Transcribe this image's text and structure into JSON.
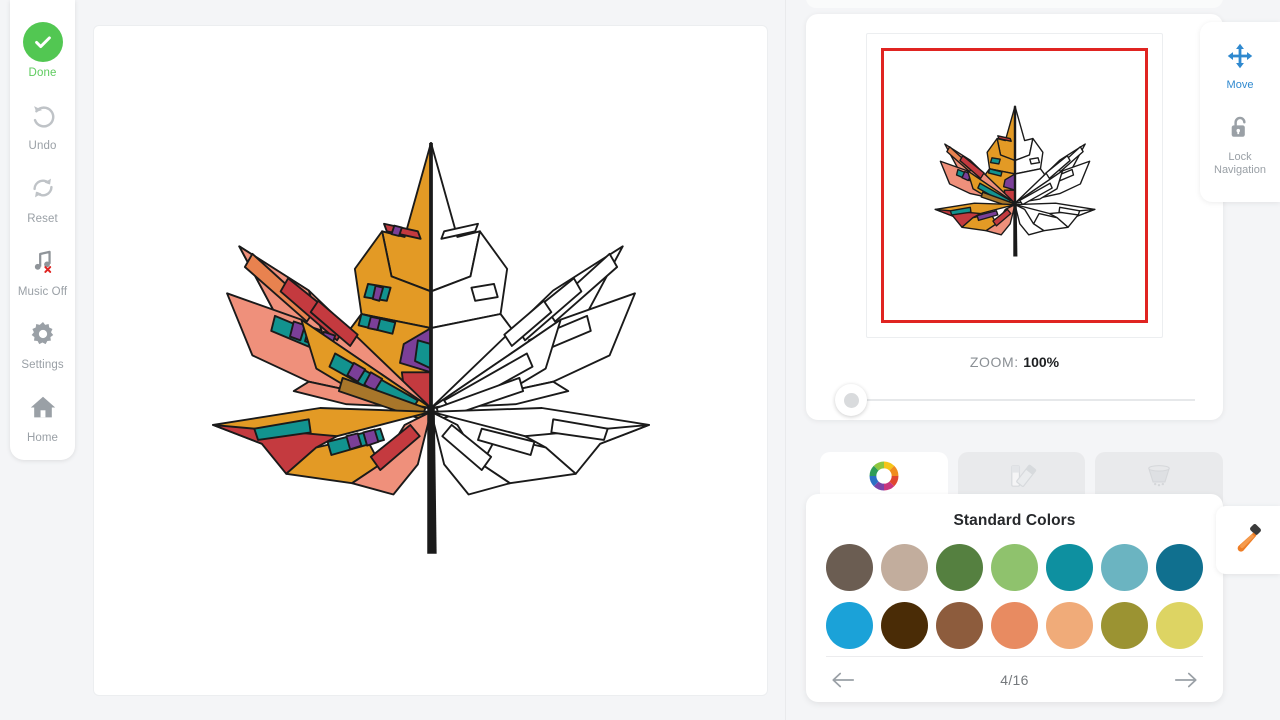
{
  "app": {
    "background": "#f4f5f7"
  },
  "toolbar": {
    "items": [
      {
        "label": "Done",
        "icon": "check-circle-icon",
        "state": "active",
        "color": "#52c752"
      },
      {
        "label": "Undo",
        "icon": "undo-arrow-icon",
        "state": "normal",
        "color": "#b9bdc1"
      },
      {
        "label": "Reset",
        "icon": "reset-refresh-icon",
        "state": "normal",
        "color": "#b9bdc1"
      },
      {
        "label": "Music Off",
        "icon": "music-note-off-icon",
        "state": "normal",
        "color": "#9aa0a6"
      },
      {
        "label": "Settings",
        "icon": "gear-icon",
        "state": "normal",
        "color": "#9aa0a6"
      },
      {
        "label": "Home",
        "icon": "home-icon",
        "state": "normal",
        "color": "#9aa0a6"
      }
    ]
  },
  "canvas": {
    "artwork_name": "maple-leaf-coloring-page",
    "description": "Stained-glass style maple leaf, left half colored, right half uncolored outline"
  },
  "preview": {
    "selection_border_color": "#e02421",
    "zoom_label": "ZOOM:",
    "zoom_value": "100%",
    "zoom_percent": 100,
    "slider_position": 0
  },
  "navigation": {
    "items": [
      {
        "label": "Move",
        "icon": "move-arrows-icon",
        "state": "active",
        "color": "#2f89cf"
      },
      {
        "label": "Lock\nNavigation",
        "label_line1": "Lock",
        "label_line2": "Navigation",
        "icon": "padlock-open-icon",
        "state": "inactive",
        "color": "#9aa0a6"
      }
    ]
  },
  "palette": {
    "tabs": [
      {
        "id": "colors",
        "icon": "color-wheel-icon",
        "active": true
      },
      {
        "id": "patterns",
        "icon": "swatch-palette-icon",
        "active": false
      },
      {
        "id": "effects",
        "icon": "paint-bucket-icon",
        "active": false
      }
    ],
    "title": "Standard Colors",
    "rows": [
      [
        {
          "name": "dark-taupe",
          "hex": "#6b5d52"
        },
        {
          "name": "warm-greige",
          "hex": "#c2ad9d"
        },
        {
          "name": "moss-green",
          "hex": "#558040"
        },
        {
          "name": "light-green",
          "hex": "#8fc26d"
        },
        {
          "name": "teal",
          "hex": "#0e90a0"
        },
        {
          "name": "sky-teal",
          "hex": "#6bb4c1"
        },
        {
          "name": "deep-teal",
          "hex": "#10708f"
        }
      ],
      [
        {
          "name": "azure-blue",
          "hex": "#1ba2d8"
        },
        {
          "name": "dark-brown",
          "hex": "#4a2c06"
        },
        {
          "name": "medium-brown",
          "hex": "#8d5c3d"
        },
        {
          "name": "salmon",
          "hex": "#e88b61"
        },
        {
          "name": "peach",
          "hex": "#f0ab79"
        },
        {
          "name": "olive",
          "hex": "#9b9332"
        },
        {
          "name": "pale-yellow",
          "hex": "#ddd463"
        }
      ]
    ],
    "footer": {
      "prev_label": "←",
      "next_label": "→",
      "page_indicator": "4/16",
      "page_current": 4,
      "page_total": 16
    },
    "eyedropper": {
      "icon": "eyedropper-icon",
      "color": "#ee7d25"
    }
  }
}
